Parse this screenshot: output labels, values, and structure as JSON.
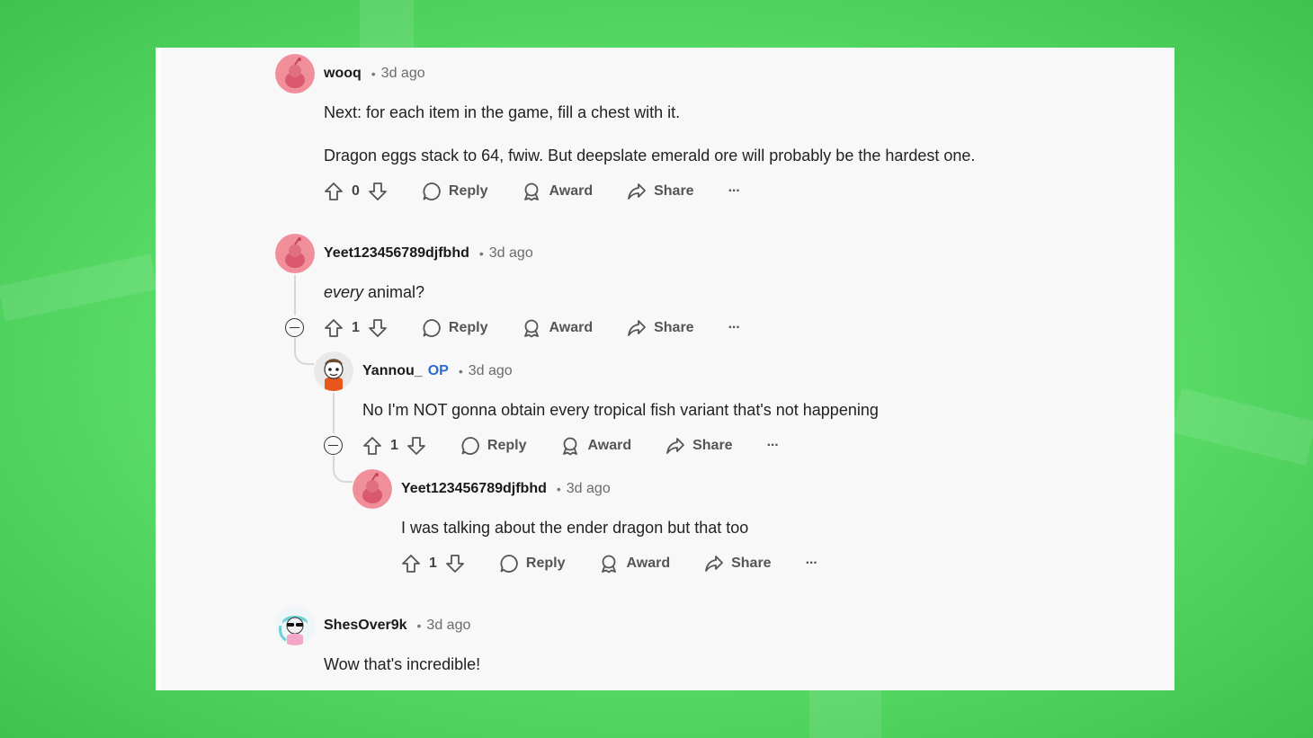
{
  "comments": [
    {
      "username": "wooq",
      "time": "3d ago",
      "lines": [
        "Next: for each item in the game, fill a chest with it.",
        "Dragon eggs stack to 64, fwiw. But deepslate emerald ore will probably be the hardest one."
      ],
      "votes": "0",
      "avatar": "snoo-pink-avatar"
    },
    {
      "username": "Yeet123456789djfbhd",
      "time": "3d ago",
      "emphasis": "every",
      "rest": " animal?",
      "votes": "1",
      "avatar": "snoo-pink-avatar"
    },
    {
      "username": "Yannou_",
      "badge": "OP",
      "time": "3d ago",
      "lines": [
        "No I'm NOT gonna obtain every tropical fish variant that's not happening"
      ],
      "votes": "1",
      "avatar": "snoo-custom-avatar"
    },
    {
      "username": "Yeet123456789djfbhd",
      "time": "3d ago",
      "lines": [
        "I was talking about the ender dragon but that too"
      ],
      "votes": "1",
      "avatar": "snoo-pink-avatar"
    },
    {
      "username": "ShesOver9k",
      "time": "3d ago",
      "lines": [
        "Wow that's incredible!"
      ],
      "avatar": "snoo-sunglasses-avatar"
    }
  ],
  "actions": {
    "reply": "Reply",
    "award": "Award",
    "share": "Share",
    "more": "···"
  },
  "colors": {
    "background": "#6ee67a",
    "panel": "#f8f8f8",
    "op_badge": "#2b6cd4",
    "avatar_pink": "#f08f9a",
    "thread_line": "#d7d7d7"
  },
  "icons": [
    "upvote-icon",
    "downvote-icon",
    "reply-bubble-icon",
    "award-icon",
    "share-icon",
    "more-icon",
    "collapse-icon"
  ]
}
